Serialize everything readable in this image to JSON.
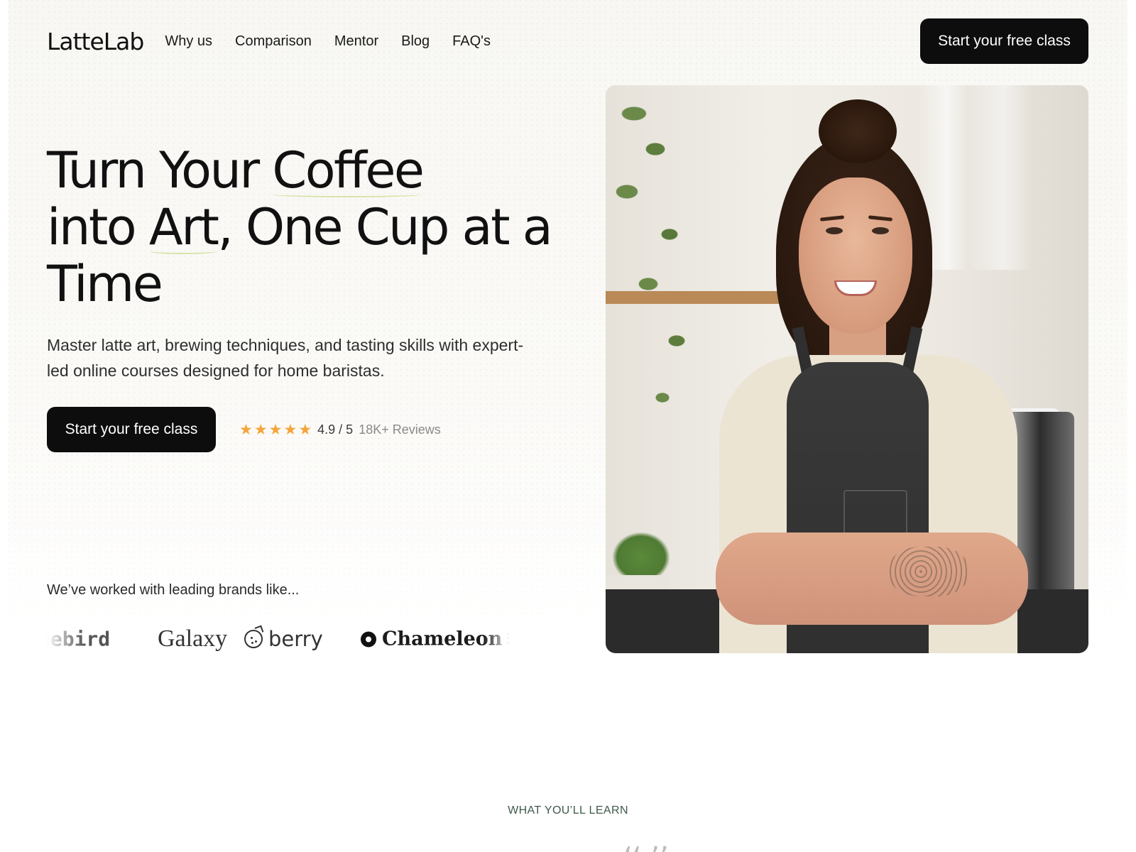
{
  "header": {
    "logo": "LatteLab",
    "nav": [
      "Why us",
      "Comparison",
      "Mentor",
      "Blog",
      "FAQ's"
    ],
    "cta_label": "Start your free class"
  },
  "hero": {
    "title": {
      "part1": "Turn Your ",
      "highlight1": "Coffee",
      "part2": "into ",
      "highlight2": "Art",
      "part3": ", One Cup at a Time"
    },
    "subtitle": "Master latte art, brewing techniques, and tasting skills with expert-led online courses designed for home baristas.",
    "cta_label": "Start your free class",
    "rating": {
      "stars": 5,
      "score": "4.9 / 5",
      "reviews": "18K+ Reviews",
      "star_color": "#f5a53a"
    },
    "brands_label": "We’ve worked with leading brands like...",
    "brands": [
      "uebird",
      "Galaxy",
      "berry",
      "Chameleon"
    ],
    "image_icon": "barista-photo"
  },
  "next_section": {
    "eyebrow": "WHAT YOU’LL LEARN"
  },
  "colors": {
    "cta_bg": "#0d0d0d",
    "highlight_underline": "#d6e4a8",
    "eyebrow": "#3f5a4b"
  }
}
